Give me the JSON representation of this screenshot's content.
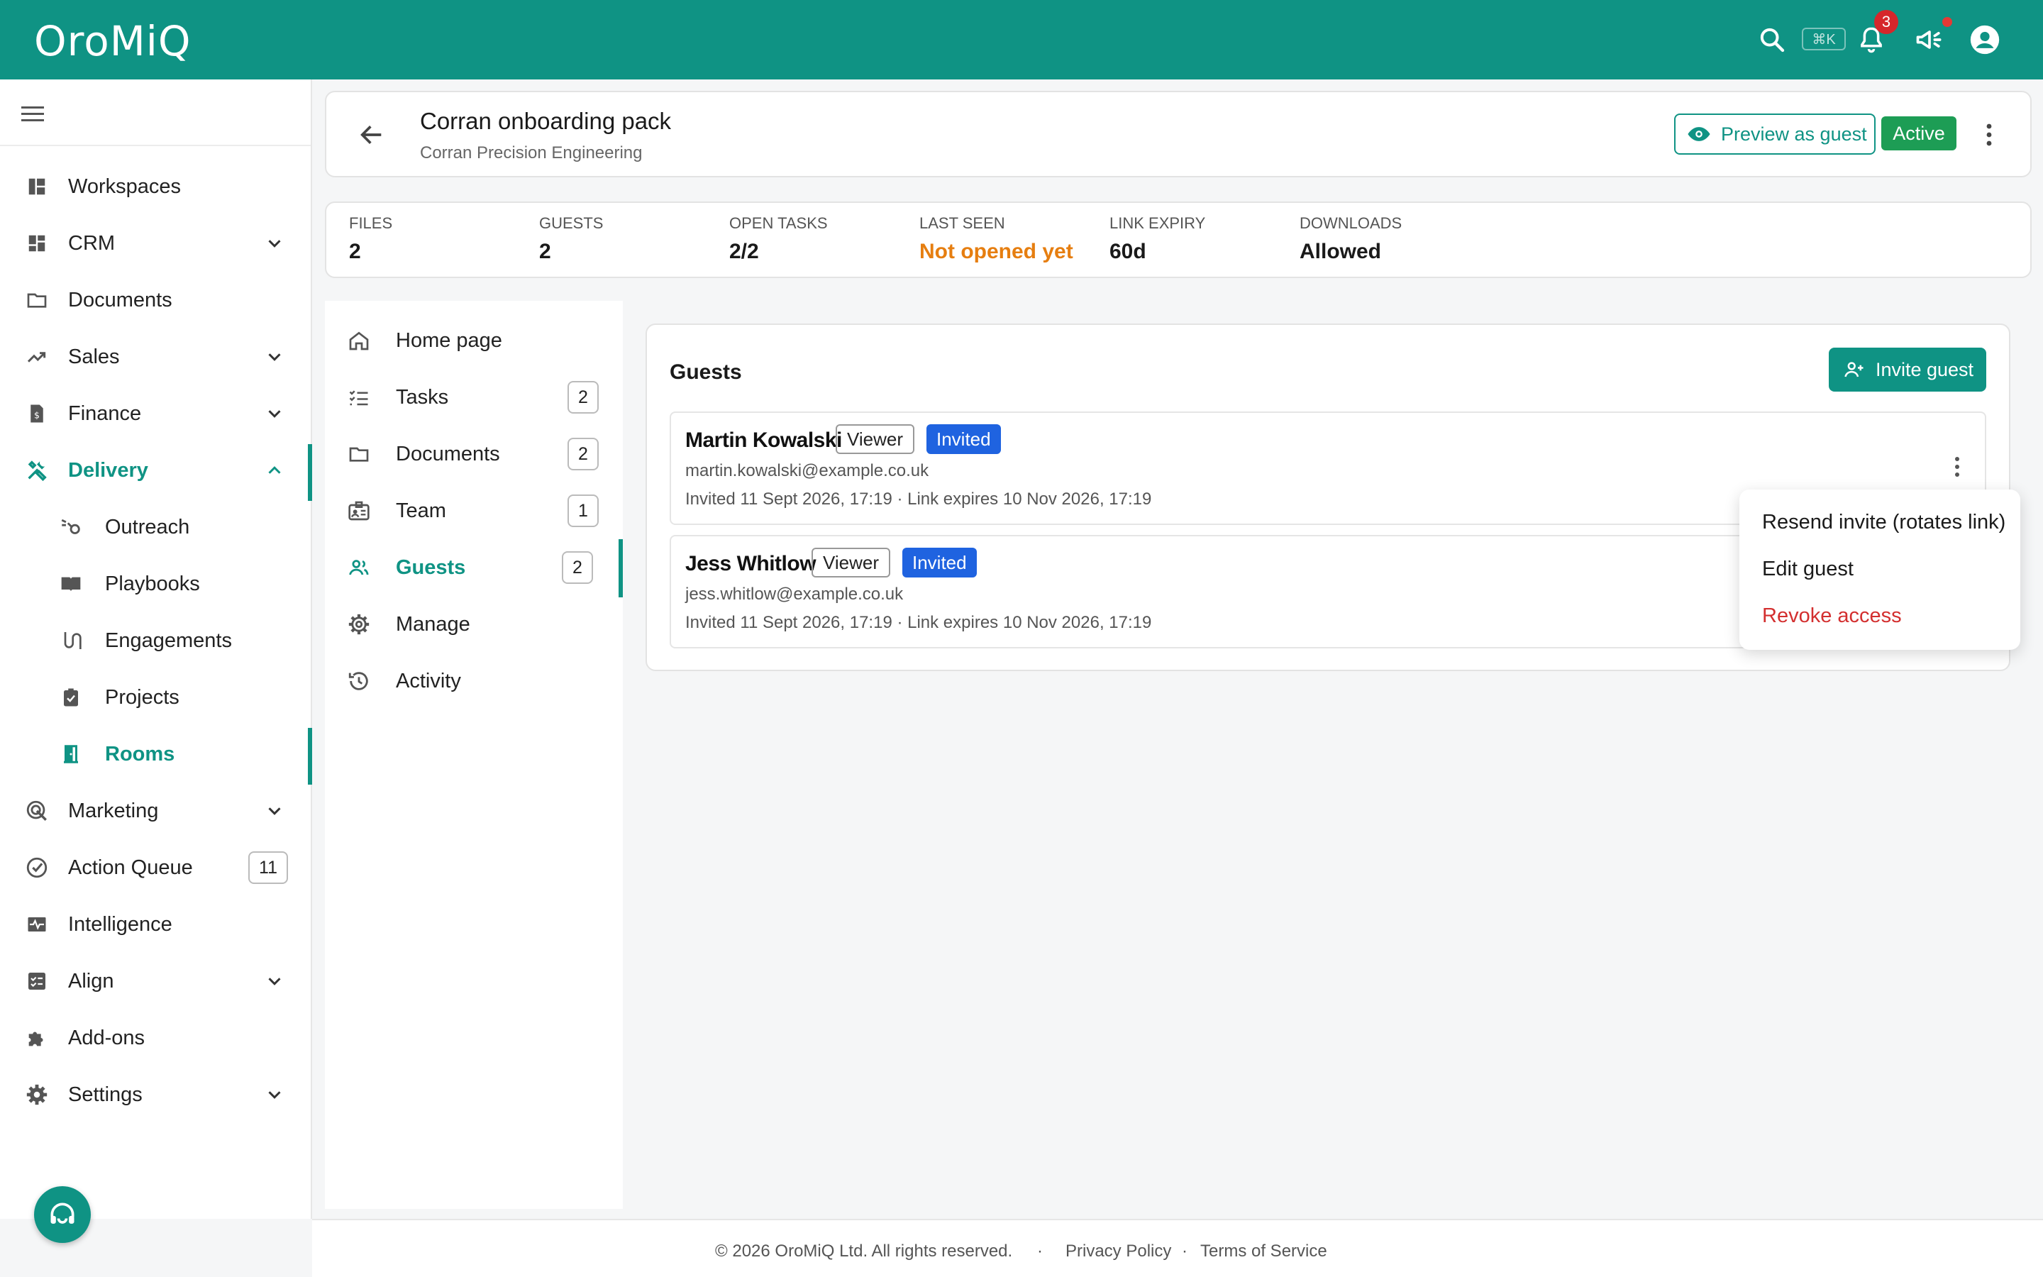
{
  "app": {
    "logo": "OroMiQ",
    "search_shortcut": "⌘K",
    "notifications_count": "3",
    "colors": {
      "brand": "#0f9384",
      "warning": "#e67e10",
      "success": "#1d9d55",
      "info": "#1f63e0",
      "danger": "#d32f2f"
    }
  },
  "sidebar": {
    "items": [
      {
        "label": "Workspaces",
        "icon": "dashboard-icon"
      },
      {
        "label": "CRM",
        "icon": "grid-icon",
        "expandable": true
      },
      {
        "label": "Documents",
        "icon": "folder-icon"
      },
      {
        "label": "Sales",
        "icon": "trending-up-icon",
        "expandable": true
      },
      {
        "label": "Finance",
        "icon": "invoice-icon",
        "expandable": true
      },
      {
        "label": "Delivery",
        "icon": "tools-icon",
        "expandable": true,
        "expanded": true,
        "active": true
      },
      {
        "label": "Outreach",
        "icon": "outreach-icon",
        "sub": true
      },
      {
        "label": "Playbooks",
        "icon": "book-icon",
        "sub": true
      },
      {
        "label": "Engagements",
        "icon": "route-icon",
        "sub": true
      },
      {
        "label": "Projects",
        "icon": "clipboard-check-icon",
        "sub": true
      },
      {
        "label": "Rooms",
        "icon": "door-icon",
        "sub": true,
        "active": true
      },
      {
        "label": "Marketing",
        "icon": "target-icon",
        "expandable": true
      },
      {
        "label": "Action Queue",
        "icon": "check-circle-icon",
        "count": "11"
      },
      {
        "label": "Intelligence",
        "icon": "pulse-icon"
      },
      {
        "label": "Align",
        "icon": "checklist-icon",
        "expandable": true
      },
      {
        "label": "Add-ons",
        "icon": "puzzle-icon"
      },
      {
        "label": "Settings",
        "icon": "gear-icon",
        "expandable": true
      }
    ]
  },
  "header": {
    "title": "Corran onboarding pack",
    "subtitle": "Corran Precision Engineering",
    "preview_label": "Preview as guest",
    "status": "Active"
  },
  "stats": [
    {
      "key": "FILES",
      "value": "2"
    },
    {
      "key": "GUESTS",
      "value": "2"
    },
    {
      "key": "OPEN TASKS",
      "value": "2/2"
    },
    {
      "key": "LAST SEEN",
      "value": "Not opened yet"
    },
    {
      "key": "LINK EXPIRY",
      "value": "60d"
    },
    {
      "key": "DOWNLOADS",
      "value": "Allowed"
    }
  ],
  "room_nav": {
    "items": [
      {
        "label": "Home page",
        "icon": "home-icon"
      },
      {
        "label": "Tasks",
        "icon": "task-list-icon",
        "count": "2"
      },
      {
        "label": "Documents",
        "icon": "folder-icon",
        "count": "2"
      },
      {
        "label": "Team",
        "icon": "badge-icon",
        "count": "1"
      },
      {
        "label": "Guests",
        "icon": "people-icon",
        "count": "2",
        "active": true
      },
      {
        "label": "Manage",
        "icon": "gear-icon"
      },
      {
        "label": "Activity",
        "icon": "history-icon"
      }
    ]
  },
  "guests": {
    "title": "Guests",
    "invite_label": "Invite guest",
    "rows": [
      {
        "name": "Martin Kowalski",
        "role": "Viewer",
        "status": "Invited",
        "email": "martin.kowalski@example.co.uk",
        "meta": "Invited 11 Sept 2026, 17:19 · Link expires 10 Nov 2026, 17:19"
      },
      {
        "name": "Jess Whitlow",
        "role": "Viewer",
        "status": "Invited",
        "email": "jess.whitlow@example.co.uk",
        "meta": "Invited 11 Sept 2026, 17:19 · Link expires 10 Nov 2026, 17:19"
      }
    ]
  },
  "row_menu": {
    "items": [
      "Resend invite (rotates link)",
      "Edit guest",
      "Revoke access"
    ]
  },
  "footer": {
    "copyright": "© 2026 OroMiQ Ltd. All rights reserved.",
    "sep": "·",
    "privacy": "Privacy Policy",
    "terms": "Terms of Service"
  }
}
